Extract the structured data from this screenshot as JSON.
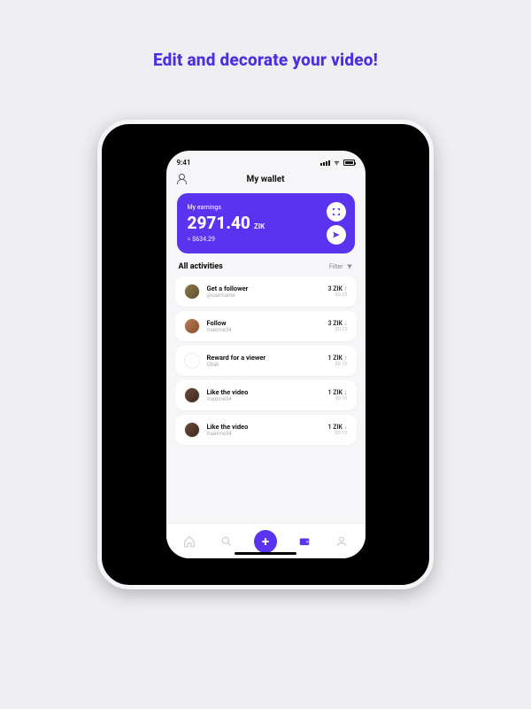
{
  "promo": {
    "title": "Edit and decorate your video!"
  },
  "statusbar": {
    "time": "9:41"
  },
  "header": {
    "title": "My wallet"
  },
  "earnings": {
    "label": "My earnings",
    "amount": "2971.40",
    "currency": "ZIK",
    "usd": "= $634.29"
  },
  "section": {
    "title": "All activities",
    "filter_label": "Filter"
  },
  "activities": [
    {
      "title": "Get a follower",
      "sub": "@username",
      "amount": "3 ZIK",
      "usd": "$0.25",
      "dir": "up",
      "avatar_bg": "linear-gradient(135deg,#8d7a4d,#5b4f2b)"
    },
    {
      "title": "Follow",
      "sub": "maxime34",
      "amount": "3 ZIK",
      "usd": "$0.25",
      "dir": "down",
      "avatar_bg": "linear-gradient(135deg,#b77b55,#8b4e2e)"
    },
    {
      "title": "Reward for a viewer",
      "sub": "Obak",
      "amount": "1 ZIK",
      "usd": "$0.10",
      "dir": "up",
      "avatar_bg": "#fff"
    },
    {
      "title": "Like the video",
      "sub": "maxime34",
      "amount": "1 ZIK",
      "usd": "$0.10",
      "dir": "down",
      "avatar_bg": "linear-gradient(135deg,#6a4838,#3f2a1f)"
    },
    {
      "title": "Like the video",
      "sub": "maxime34",
      "amount": "1 ZIK",
      "usd": "$0.10",
      "dir": "down",
      "avatar_bg": "linear-gradient(135deg,#6a4838,#3f2a1f)"
    }
  ],
  "colors": {
    "accent": "#5a33f0"
  }
}
